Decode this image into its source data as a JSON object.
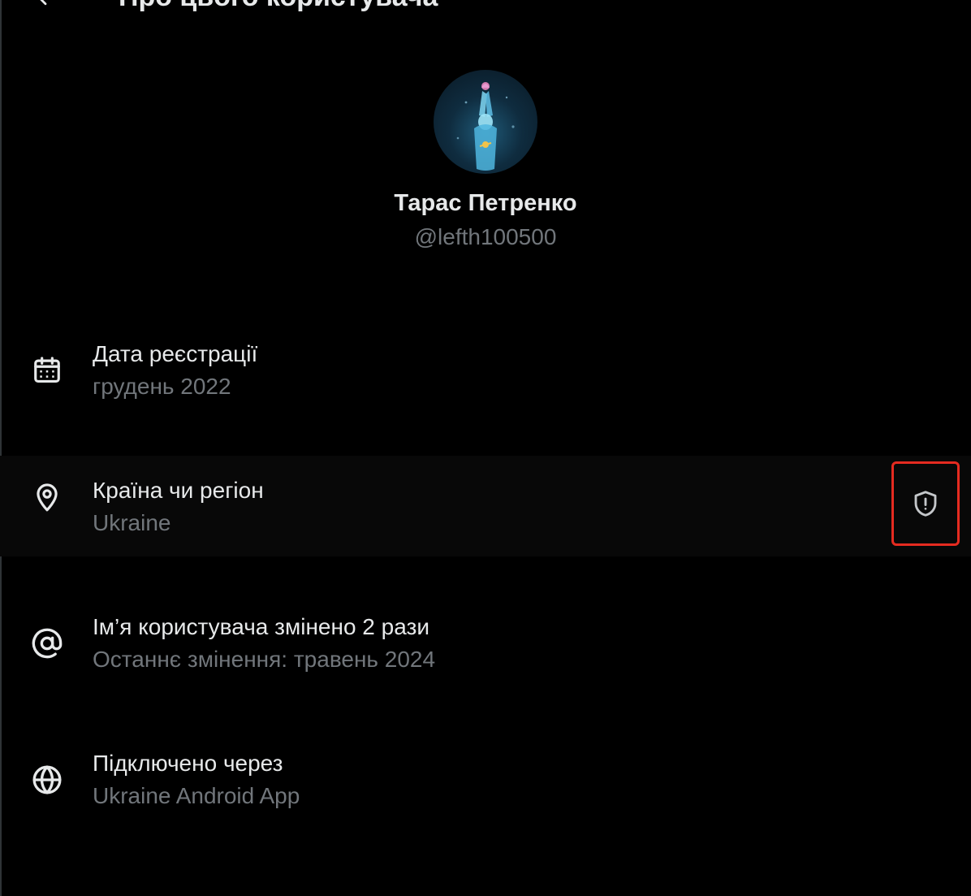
{
  "header": {
    "title": "Про цього користувача",
    "back_icon": "arrow-left-icon"
  },
  "profile": {
    "name": "Тарас Петренко",
    "handle": "@lefth100500",
    "avatar_icon": "avatar-image"
  },
  "rows": [
    {
      "icon": "calendar-icon",
      "title": "Дата реєстрації",
      "subtitle": "грудень 2022"
    },
    {
      "icon": "location-pin-icon",
      "title": "Країна чи регіон",
      "subtitle": "Ukraine",
      "action_icon": "shield-alert-icon"
    },
    {
      "icon": "at-sign-icon",
      "title": "Ім’я користувача змінено 2 рази",
      "subtitle": "Останнє змінення: травень 2024"
    },
    {
      "icon": "globe-icon",
      "title": "Підключено через",
      "subtitle": "Ukraine Android App"
    }
  ],
  "colors": {
    "background": "#000000",
    "primary_text": "#e7e9ea",
    "secondary_text": "#71767b",
    "highlight_border": "#e52b20"
  }
}
